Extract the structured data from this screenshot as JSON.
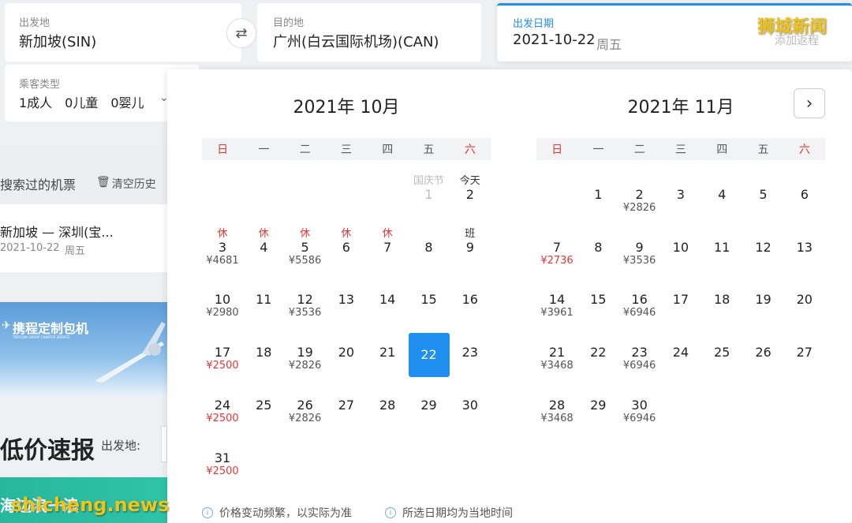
{
  "search": {
    "from_label": "出发地",
    "from_value": "新加坡(SIN)",
    "to_label": "目的地",
    "to_value": "广州(白云国际机场)(CAN)",
    "date_label": "出发日期",
    "date_value": "2021-10-22",
    "date_weekday": "周五",
    "add_return": "添加返程",
    "passenger_label": "乘客类型",
    "passenger_value": "1成人　0儿童　0婴儿",
    "swap_icon": "swap-icon"
  },
  "history": {
    "title": "搜索过的机票",
    "clear": "清空历史",
    "item_route": "新加坡 — 深圳(宝...",
    "item_date": "2021-10-22",
    "item_weekday": "周五"
  },
  "banner": {
    "brand": "携程定制包机",
    "brand_sub": "TRIP.COM GROUP CHARTER SERVICE",
    "deals_title": "低价速报",
    "deals_from_label": "出发地:",
    "bottom_text": "海边浪一浪"
  },
  "calendar": {
    "weekdays": [
      "日",
      "一",
      "二",
      "三",
      "四",
      "五",
      "六"
    ],
    "months": [
      {
        "title": "2021年 10月",
        "cells": [
          {
            "col": 5,
            "row": 0,
            "top": "国庆节",
            "topStyle": "grey",
            "day": "1",
            "dayStyle": "grey",
            "price": ""
          },
          {
            "col": 6,
            "row": 0,
            "top": "今天",
            "topStyle": "dark",
            "day": "2",
            "price": ""
          },
          {
            "col": 0,
            "row": 1,
            "top": "休",
            "topStyle": "red",
            "day": "3",
            "price": "¥4681"
          },
          {
            "col": 1,
            "row": 1,
            "top": "休",
            "topStyle": "red",
            "day": "4",
            "price": ""
          },
          {
            "col": 2,
            "row": 1,
            "top": "休",
            "topStyle": "red",
            "day": "5",
            "price": "¥5586"
          },
          {
            "col": 3,
            "row": 1,
            "top": "休",
            "topStyle": "red",
            "day": "6",
            "price": ""
          },
          {
            "col": 4,
            "row": 1,
            "top": "休",
            "topStyle": "red",
            "day": "7",
            "price": ""
          },
          {
            "col": 5,
            "row": 1,
            "top": "",
            "day": "8",
            "price": ""
          },
          {
            "col": 6,
            "row": 1,
            "top": "班",
            "topStyle": "dark",
            "day": "9",
            "price": ""
          },
          {
            "col": 0,
            "row": 2,
            "top": "",
            "day": "10",
            "price": "¥2980"
          },
          {
            "col": 1,
            "row": 2,
            "top": "",
            "day": "11",
            "price": ""
          },
          {
            "col": 2,
            "row": 2,
            "top": "",
            "day": "12",
            "price": "¥3536"
          },
          {
            "col": 3,
            "row": 2,
            "top": "",
            "day": "13",
            "price": ""
          },
          {
            "col": 4,
            "row": 2,
            "top": "",
            "day": "14",
            "price": ""
          },
          {
            "col": 5,
            "row": 2,
            "top": "",
            "day": "15",
            "price": ""
          },
          {
            "col": 6,
            "row": 2,
            "top": "",
            "day": "16",
            "price": ""
          },
          {
            "col": 0,
            "row": 3,
            "top": "",
            "day": "17",
            "price": "¥2500",
            "priceStyle": "red"
          },
          {
            "col": 1,
            "row": 3,
            "top": "",
            "day": "18",
            "price": ""
          },
          {
            "col": 2,
            "row": 3,
            "top": "",
            "day": "19",
            "price": "¥2826"
          },
          {
            "col": 3,
            "row": 3,
            "top": "",
            "day": "20",
            "price": ""
          },
          {
            "col": 4,
            "row": 3,
            "top": "",
            "day": "21",
            "price": ""
          },
          {
            "col": 5,
            "row": 3,
            "top": "",
            "day": "22",
            "price": "",
            "selected": true
          },
          {
            "col": 6,
            "row": 3,
            "top": "",
            "day": "23",
            "price": ""
          },
          {
            "col": 0,
            "row": 4,
            "top": "",
            "day": "24",
            "price": "¥2500",
            "priceStyle": "red"
          },
          {
            "col": 1,
            "row": 4,
            "top": "",
            "day": "25",
            "price": ""
          },
          {
            "col": 2,
            "row": 4,
            "top": "",
            "day": "26",
            "price": "¥2826"
          },
          {
            "col": 3,
            "row": 4,
            "top": "",
            "day": "27",
            "price": ""
          },
          {
            "col": 4,
            "row": 4,
            "top": "",
            "day": "28",
            "price": ""
          },
          {
            "col": 5,
            "row": 4,
            "top": "",
            "day": "29",
            "price": ""
          },
          {
            "col": 6,
            "row": 4,
            "top": "",
            "day": "30",
            "price": ""
          },
          {
            "col": 0,
            "row": 5,
            "top": "",
            "day": "31",
            "price": "¥2500",
            "priceStyle": "red"
          }
        ]
      },
      {
        "title": "2021年 11月",
        "cells": [
          {
            "col": 1,
            "row": 0,
            "top": "",
            "day": "1",
            "price": ""
          },
          {
            "col": 2,
            "row": 0,
            "top": "",
            "day": "2",
            "price": "¥2826"
          },
          {
            "col": 3,
            "row": 0,
            "top": "",
            "day": "3",
            "price": ""
          },
          {
            "col": 4,
            "row": 0,
            "top": "",
            "day": "4",
            "price": ""
          },
          {
            "col": 5,
            "row": 0,
            "top": "",
            "day": "5",
            "price": ""
          },
          {
            "col": 6,
            "row": 0,
            "top": "",
            "day": "6",
            "price": ""
          },
          {
            "col": 0,
            "row": 1,
            "top": "",
            "day": "7",
            "price": "¥2736",
            "priceStyle": "red"
          },
          {
            "col": 1,
            "row": 1,
            "top": "",
            "day": "8",
            "price": ""
          },
          {
            "col": 2,
            "row": 1,
            "top": "",
            "day": "9",
            "price": "¥3536"
          },
          {
            "col": 3,
            "row": 1,
            "top": "",
            "day": "10",
            "price": ""
          },
          {
            "col": 4,
            "row": 1,
            "top": "",
            "day": "11",
            "price": ""
          },
          {
            "col": 5,
            "row": 1,
            "top": "",
            "day": "12",
            "price": ""
          },
          {
            "col": 6,
            "row": 1,
            "top": "",
            "day": "13",
            "price": ""
          },
          {
            "col": 0,
            "row": 2,
            "top": "",
            "day": "14",
            "price": "¥3961"
          },
          {
            "col": 1,
            "row": 2,
            "top": "",
            "day": "15",
            "price": ""
          },
          {
            "col": 2,
            "row": 2,
            "top": "",
            "day": "16",
            "price": "¥6946"
          },
          {
            "col": 3,
            "row": 2,
            "top": "",
            "day": "17",
            "price": ""
          },
          {
            "col": 4,
            "row": 2,
            "top": "",
            "day": "18",
            "price": ""
          },
          {
            "col": 5,
            "row": 2,
            "top": "",
            "day": "19",
            "price": ""
          },
          {
            "col": 6,
            "row": 2,
            "top": "",
            "day": "20",
            "price": ""
          },
          {
            "col": 0,
            "row": 3,
            "top": "",
            "day": "21",
            "price": "¥3468"
          },
          {
            "col": 1,
            "row": 3,
            "top": "",
            "day": "22",
            "price": ""
          },
          {
            "col": 2,
            "row": 3,
            "top": "",
            "day": "23",
            "price": "¥6946"
          },
          {
            "col": 3,
            "row": 3,
            "top": "",
            "day": "24",
            "price": ""
          },
          {
            "col": 4,
            "row": 3,
            "top": "",
            "day": "25",
            "price": ""
          },
          {
            "col": 5,
            "row": 3,
            "top": "",
            "day": "26",
            "price": ""
          },
          {
            "col": 6,
            "row": 3,
            "top": "",
            "day": "27",
            "price": ""
          },
          {
            "col": 0,
            "row": 4,
            "top": "",
            "day": "28",
            "price": "¥3468"
          },
          {
            "col": 1,
            "row": 4,
            "top": "",
            "day": "29",
            "price": ""
          },
          {
            "col": 2,
            "row": 4,
            "top": "",
            "day": "30",
            "price": "¥6946"
          }
        ]
      }
    ],
    "note_1": "价格变动频繁，以实际为准",
    "note_2": "所选日期均为当地时间",
    "next_icon": "chevron-right-icon",
    "colors": {
      "selected": "#1f8ff0",
      "holiday": "#e33333"
    }
  },
  "watermark": {
    "top": "狮城新闻",
    "bottom": "shicheng.news"
  }
}
